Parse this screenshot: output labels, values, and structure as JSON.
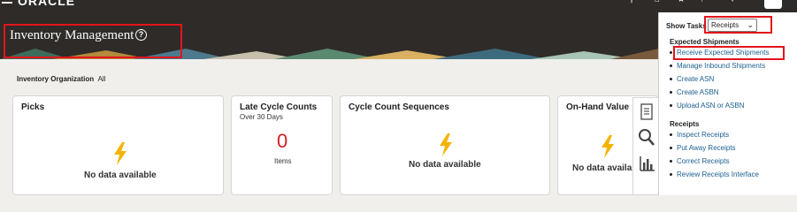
{
  "topbar": {
    "logo": "ORACLE"
  },
  "header": {
    "title": "Inventory Management"
  },
  "main": {
    "org_label": "Inventory Organization",
    "org_value": "All",
    "cards": [
      {
        "title": "Picks",
        "subtitle": "",
        "nodata": "No data available"
      },
      {
        "title": "Late Cycle Counts",
        "subtitle": "Over 30 Days",
        "value": "0",
        "unit": "Items"
      },
      {
        "title": "Cycle Count Sequences",
        "subtitle": "",
        "nodata": "No data available"
      },
      {
        "title": "On-Hand Value",
        "subtitle": "",
        "nodata": "No data available"
      }
    ]
  },
  "tasks_panel": {
    "show_tasks_label": "Show Tasks",
    "selected": "Receipts",
    "groups": [
      {
        "title": "Expected Shipments",
        "items": [
          "Receive Expected Shipments",
          "Manage Inbound Shipments",
          "Create ASN",
          "Create ASBN",
          "Upload ASN or ASBN"
        ]
      },
      {
        "title": "Receipts",
        "items": [
          "Inspect Receipts",
          "Put Away Receipts",
          "Correct Receipts",
          "Review Receipts Interface"
        ]
      }
    ]
  },
  "colors": {
    "header_bg": "#2e2b28",
    "highlight": "#e2141b",
    "link": "#1b5f8f",
    "alert": "#d11f1f",
    "bolt": "#f5b300"
  }
}
